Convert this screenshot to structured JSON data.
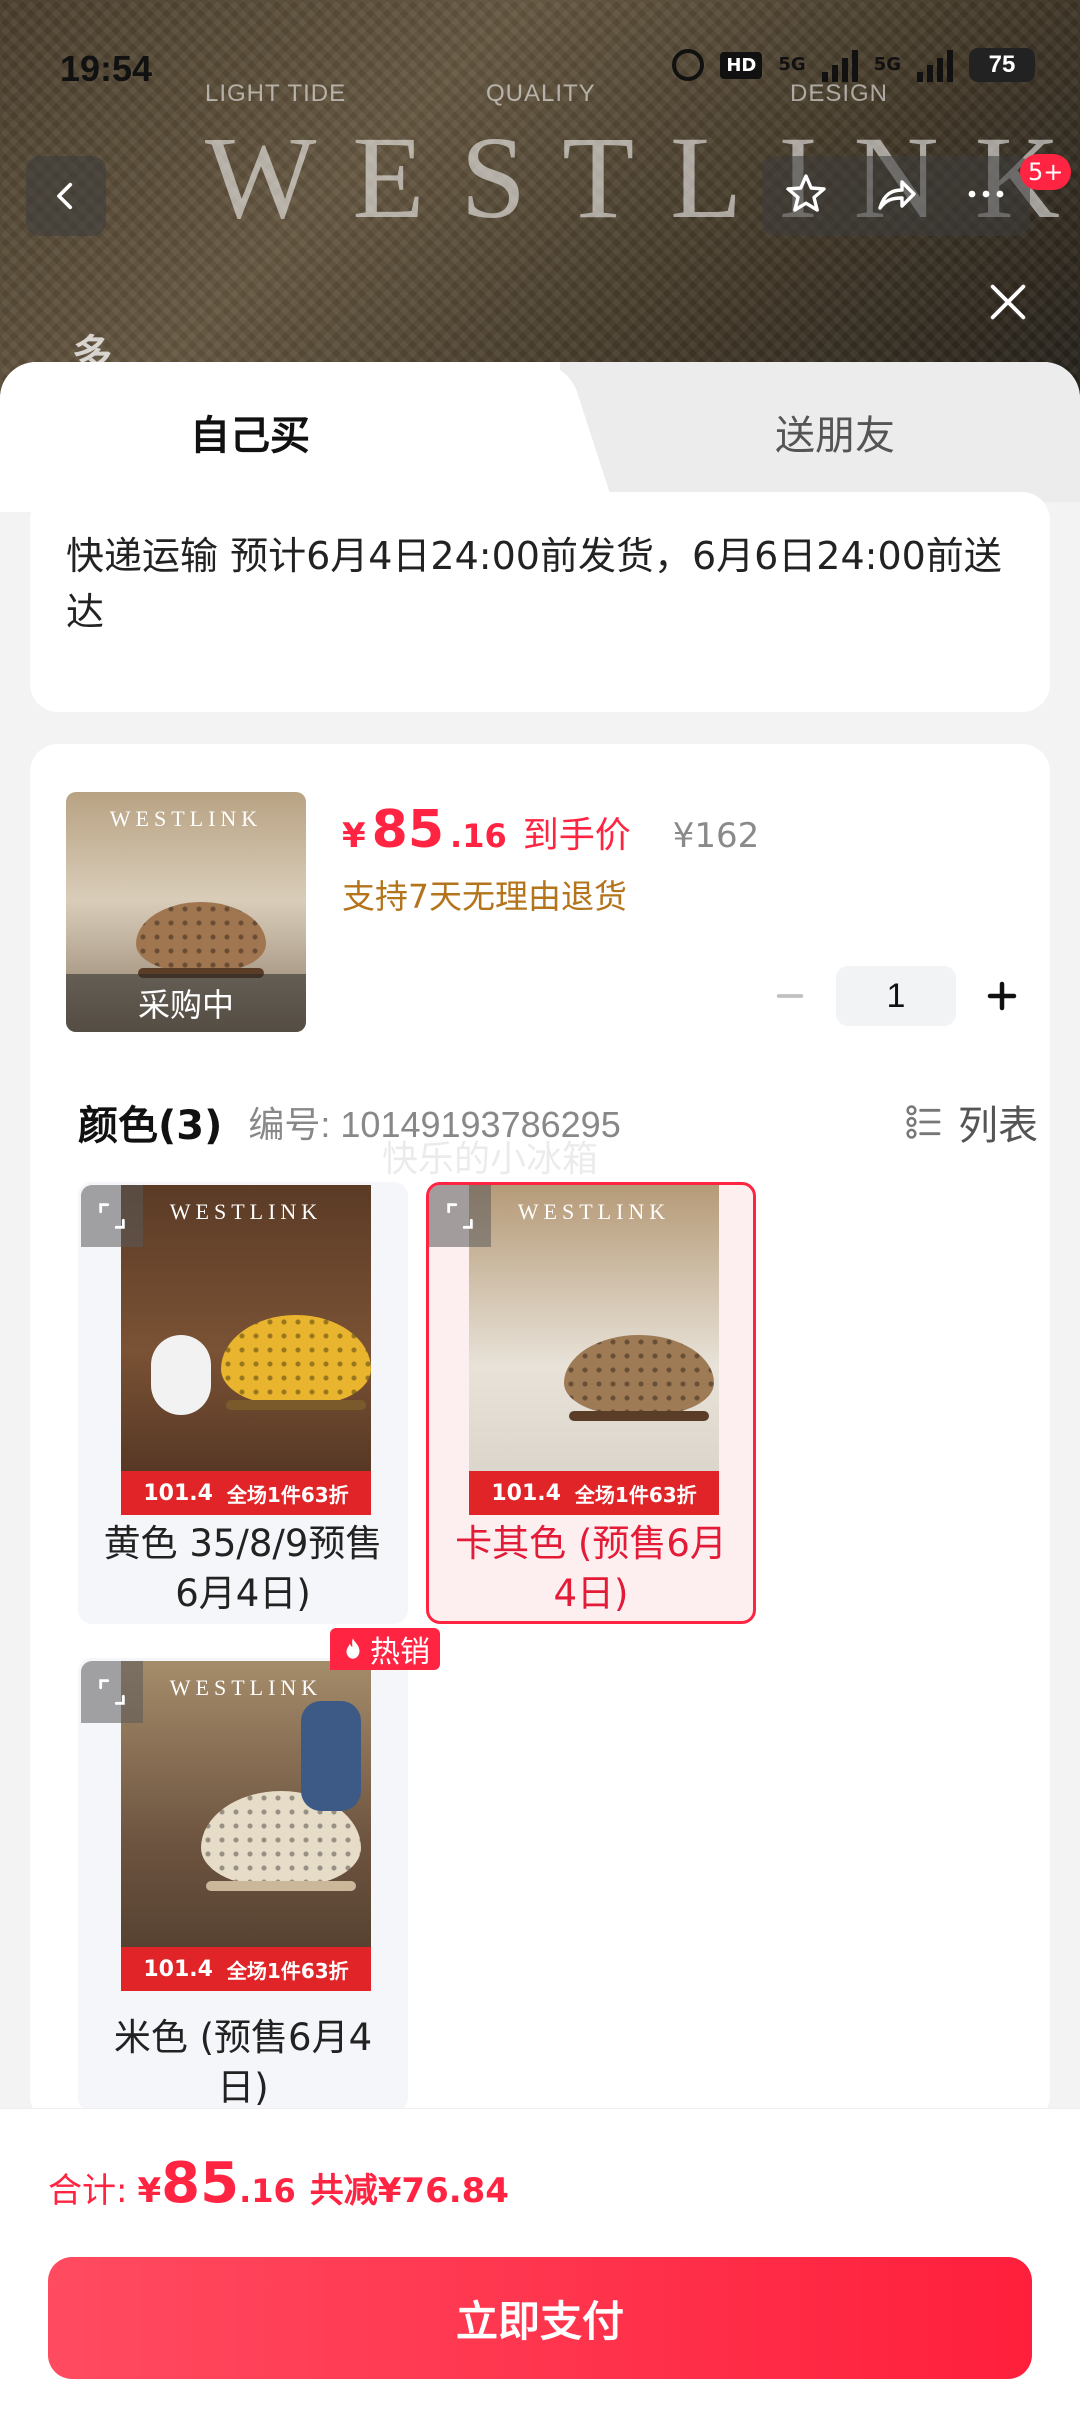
{
  "status_bar": {
    "time": "19:54",
    "hd_label": "HD",
    "network_1": "5G",
    "network_2": "5G",
    "battery": "75"
  },
  "backdrop": {
    "brand_small_left": "LIGHT TIDE",
    "brand_small_center": "QUALITY",
    "brand_small_right": "DESIGN",
    "brand": "WESTLINK",
    "partial_label": "多",
    "notification_count": "5+"
  },
  "tabs": {
    "self_buy": "自己买",
    "gift": "送朋友"
  },
  "delivery": {
    "text": "快递运输 预计6月4日24:00前发货，6月6日24:00前送达"
  },
  "product": {
    "thumb_overlay": "采购中",
    "price_symbol": "¥",
    "price_main": "85",
    "price_decimal": ".16",
    "price_label": "到手价",
    "original_price": "¥162",
    "return_policy": "支持7天无理由退货",
    "quantity": "1"
  },
  "color_section": {
    "title": "颜色(3)",
    "code": "编号: 10149193786295",
    "list_label": "列表",
    "watermark": "快乐的小冰箱",
    "variants": [
      {
        "label": "黄色 35/8/9预售6月4日)",
        "selected": false
      },
      {
        "label": "卡其色 (预售6月4日)",
        "selected": true
      },
      {
        "label": "米色 (预售6月4日)",
        "selected": false
      }
    ],
    "hot_badge": "热销",
    "image_logo": "WESTLINK",
    "promo_price": "101.4",
    "promo_text": "全场1件63折"
  },
  "bottom": {
    "total_label": "合计:",
    "total_symbol": "¥",
    "total_main": "85",
    "total_decimal": ".16",
    "saved": "共减¥76.84",
    "pay_button": "立即支付"
  },
  "colors": {
    "accent": "#ff2442",
    "policy": "#b3741c",
    "muted": "#888888"
  }
}
